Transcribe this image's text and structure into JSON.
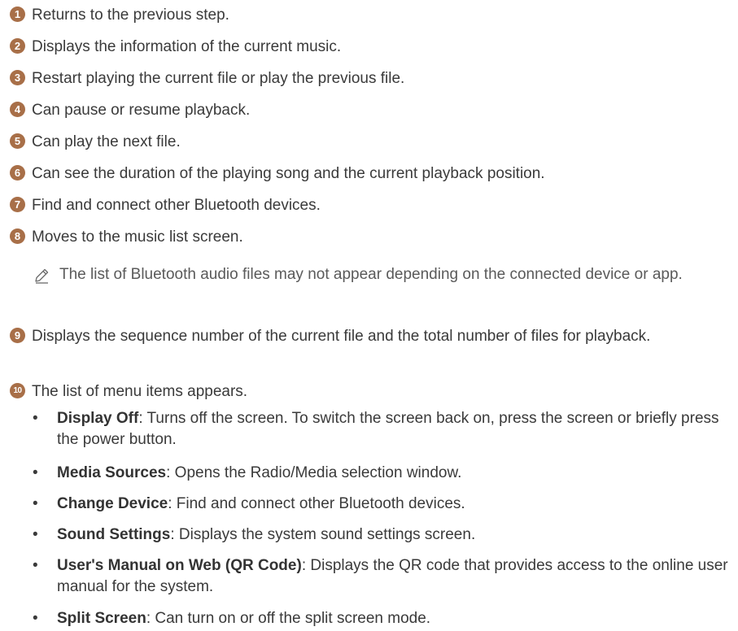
{
  "items": [
    {
      "num": "1",
      "text": "Returns to the previous step."
    },
    {
      "num": "2",
      "text": "Displays the information of the current music."
    },
    {
      "num": "3",
      "text": "Restart playing the current file or play the previous file."
    },
    {
      "num": "4",
      "text": "Can pause or resume playback."
    },
    {
      "num": "5",
      "text": "Can play the next file."
    },
    {
      "num": "6",
      "text": "Can see the duration of the playing song and the current playback position."
    },
    {
      "num": "7",
      "text": "Find and connect other Bluetooth devices."
    },
    {
      "num": "8",
      "text": "Moves to the music list screen."
    },
    {
      "num": "9",
      "text": "Displays the sequence number of the current file and the total number of files for playback."
    },
    {
      "num": "10",
      "text": "The list of menu items appears."
    }
  ],
  "note": {
    "icon": "pencil-icon",
    "text": "The list of Bluetooth audio files may not appear depending on the connected device or app."
  },
  "menu_items": [
    {
      "term": "Display Off",
      "desc": ": Turns off the screen. To switch the screen back on, press the screen or briefly press the power button."
    },
    {
      "term": "Media Sources",
      "desc": ": Opens the Radio/Media selection window."
    },
    {
      "term": "Change Device",
      "desc": ": Find and connect other Bluetooth devices."
    },
    {
      "term": "Sound Settings",
      "desc": ": Displays the system sound settings screen."
    },
    {
      "term": "User's Manual on Web (QR Code)",
      "desc": ": Displays the QR code that provides access to the online user manual for the system."
    },
    {
      "term": "Split Screen",
      "desc": ": Can turn on or off the split screen mode."
    }
  ],
  "bullet_char": "•",
  "colors": {
    "badge": "#a86f48",
    "text": "#3a3a3a",
    "note_text": "#5a5a5a"
  }
}
